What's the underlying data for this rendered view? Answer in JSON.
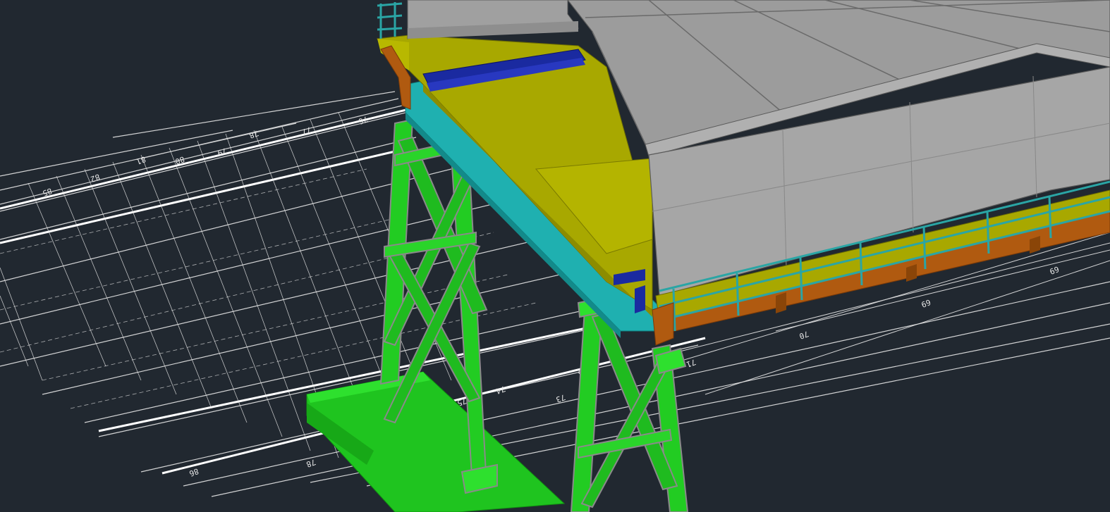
{
  "viewport": {
    "background": "#212830",
    "colors": {
      "linework": "#e8e8e8",
      "frame_green": "#22cc22",
      "frame_green_dark": "#18a018",
      "roof_gray": "#9a9a9a",
      "wall_gray": "#a3a3a3",
      "deck_yellow": "#a8a800",
      "beam_cyan": "#1fb0b0",
      "rail_teal": "#2aa5a5",
      "steel_orange": "#b05a10",
      "duct_blue": "#1a2aa0"
    }
  },
  "model": {
    "frames": [
      "left-trestle-frame",
      "right-trestle-frame"
    ],
    "structures": [
      "building-roof",
      "building-wall",
      "deck-platform",
      "cyan-edge-beam",
      "railing",
      "orange-support-beam",
      "blue-duct"
    ]
  },
  "drawing": {
    "labels": [
      "85",
      "82",
      "80",
      "81",
      "79",
      "78",
      "77",
      "76",
      "75",
      "74",
      "73",
      "72",
      "71",
      "70",
      "69",
      "69"
    ]
  }
}
